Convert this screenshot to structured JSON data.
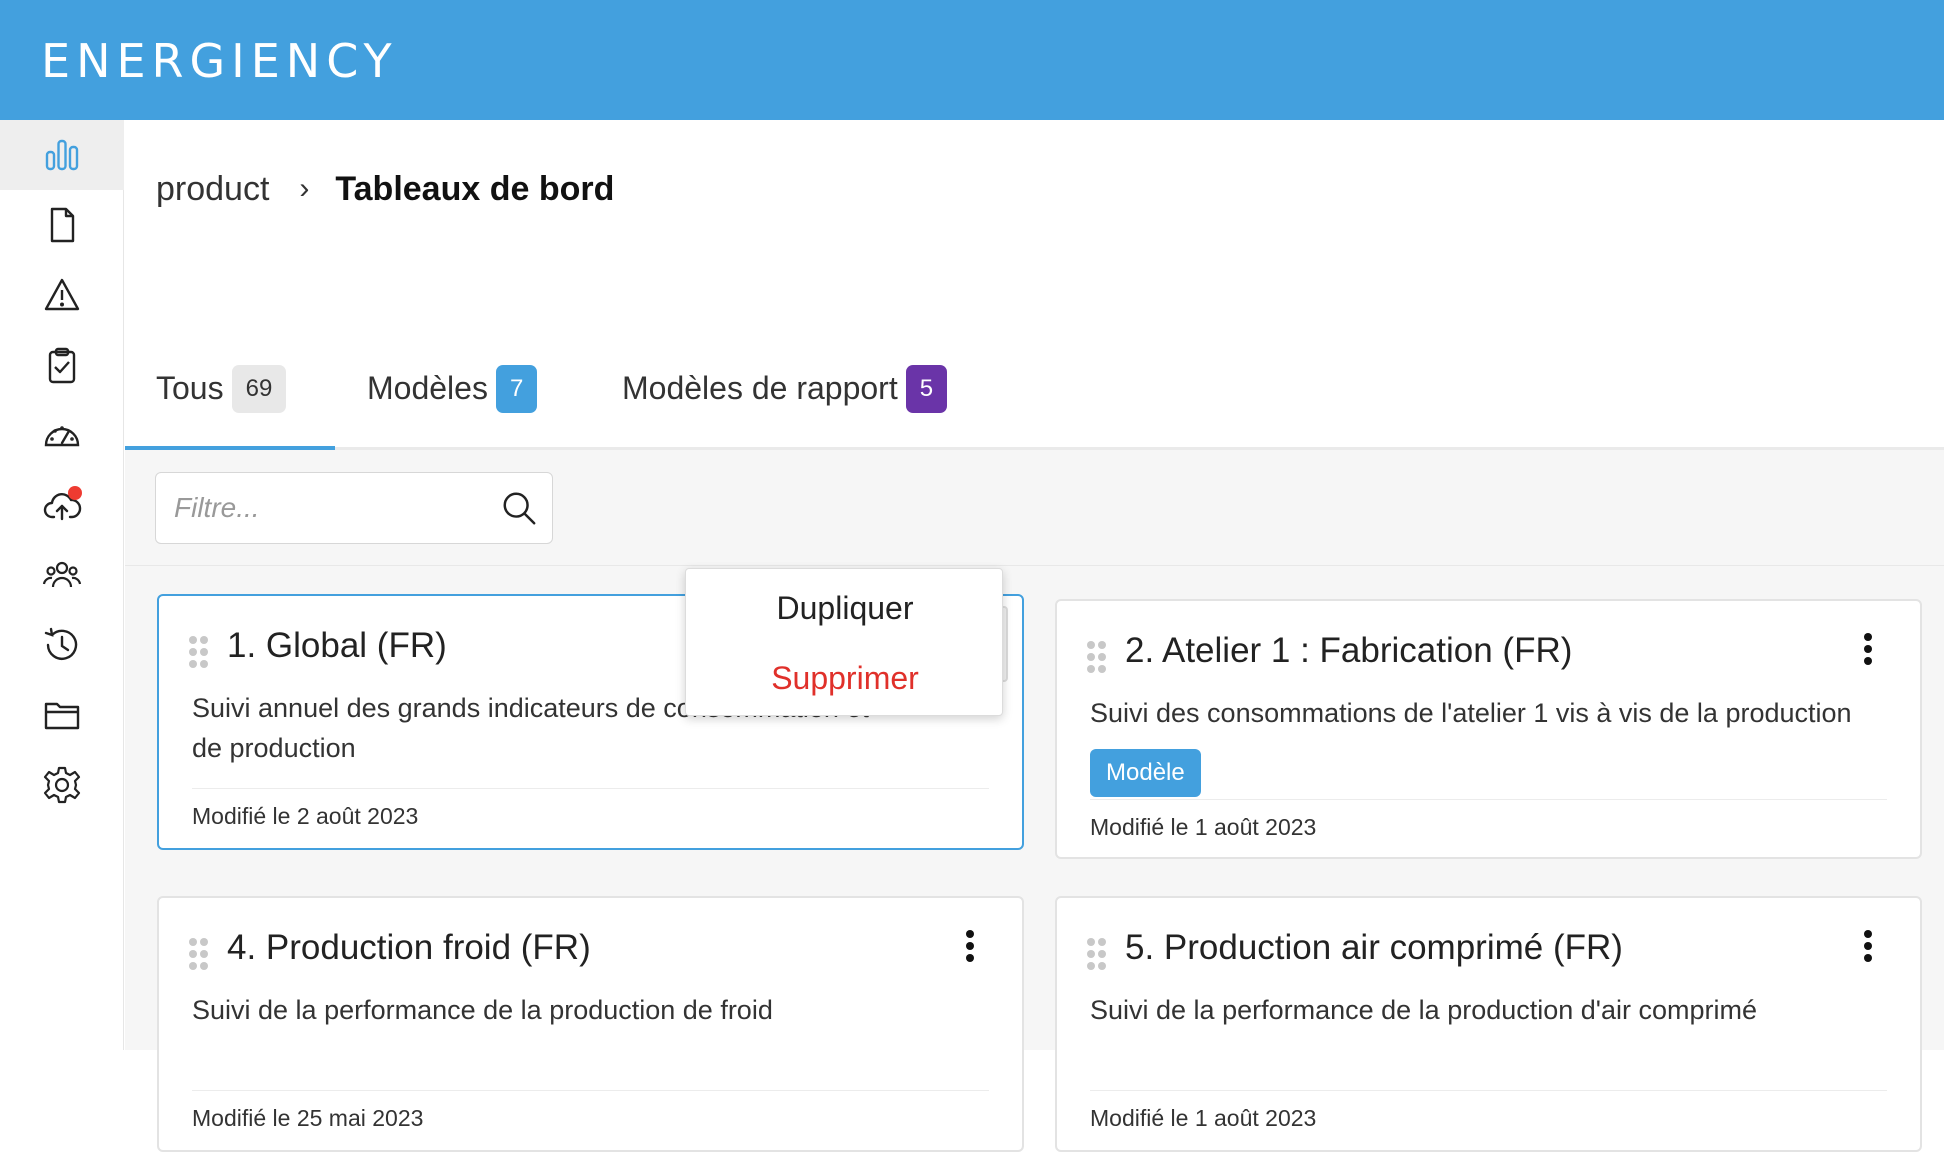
{
  "app": {
    "logo": "ENERGIENCY",
    "accent_color": "#43a0de"
  },
  "sidebar": {
    "items": [
      {
        "icon": "bar-chart-icon",
        "active": true
      },
      {
        "icon": "document-icon",
        "active": false
      },
      {
        "icon": "warning-icon",
        "active": false
      },
      {
        "icon": "clipboard-check-icon",
        "active": false
      },
      {
        "icon": "gauge-icon",
        "active": false
      },
      {
        "icon": "cloud-upload-icon",
        "active": false,
        "notification": true
      },
      {
        "icon": "users-icon",
        "active": false
      },
      {
        "icon": "history-icon",
        "active": false
      },
      {
        "icon": "folder-icon",
        "active": false
      },
      {
        "icon": "settings-icon",
        "active": false
      }
    ]
  },
  "breadcrumb": {
    "root": "product",
    "separator": "›",
    "current": "Tableaux de bord"
  },
  "tabs": [
    {
      "label": "Tous",
      "count": "69",
      "active": true
    },
    {
      "label": "Modèles",
      "count": "7",
      "active": false
    },
    {
      "label": "Modèles de rapport",
      "count": "5",
      "active": false
    }
  ],
  "filter": {
    "placeholder": "Filtre..."
  },
  "cards": [
    {
      "title": "1. Global (FR)",
      "description": "Suivi annuel des grands indicateurs de consommation et de production",
      "date": "Modifié le 2 août 2023",
      "tag": null,
      "menu_open": true
    },
    {
      "title": "2. Atelier 1 : Fabrication (FR)",
      "description": "Suivi des consommations de l'atelier 1 vis à vis de la production",
      "date": "Modifié le 1 août 2023",
      "tag": "Modèle",
      "menu_open": false
    },
    {
      "title": "4. Production froid (FR)",
      "description": "Suivi de la performance de la production de froid",
      "date": "Modifié le 25 mai 2023",
      "tag": null,
      "menu_open": false
    },
    {
      "title": "5. Production air comprimé (FR)",
      "description": "Suivi de la performance de la production d'air comprimé",
      "date": "Modifié le 1 août 2023",
      "tag": null,
      "menu_open": false
    }
  ],
  "card_menu": {
    "duplicate": "Dupliquer",
    "delete": "Supprimer"
  }
}
